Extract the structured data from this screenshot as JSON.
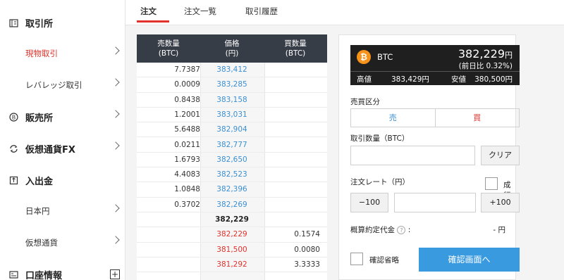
{
  "sidebar": {
    "items": [
      {
        "label": "取引所",
        "icon": "building-icon"
      },
      {
        "label": "現物取引"
      },
      {
        "label": "レバレッジ取引"
      },
      {
        "label": "販売所",
        "icon": "bitcoin-circle-icon"
      },
      {
        "label": "仮想通貨FX",
        "icon": "swap-arrows-icon"
      },
      {
        "label": "入出金",
        "icon": "deposit-icon"
      },
      {
        "label": "日本円"
      },
      {
        "label": "仮想通貨"
      },
      {
        "label": "口座情報",
        "icon": "account-icon"
      }
    ]
  },
  "tabs": [
    "注文",
    "注文一覧",
    "取引履歴"
  ],
  "orderbook": {
    "headers": {
      "sell": [
        "売数量",
        "(BTC)"
      ],
      "price": [
        "価格",
        "(円)"
      ],
      "buy": [
        "買数量",
        "(BTC)"
      ]
    },
    "asks": [
      {
        "qty": "7.7387",
        "price": "383,412"
      },
      {
        "qty": "0.0009",
        "price": "383,285"
      },
      {
        "qty": "0.8438",
        "price": "383,158"
      },
      {
        "qty": "1.2001",
        "price": "383,031"
      },
      {
        "qty": "5.6488",
        "price": "382,904"
      },
      {
        "qty": "0.0211",
        "price": "382,777"
      },
      {
        "qty": "1.6793",
        "price": "382,650"
      },
      {
        "qty": "4.4083",
        "price": "382,523"
      },
      {
        "qty": "1.0848",
        "price": "382,396"
      },
      {
        "qty": "0.3702",
        "price": "382,269"
      }
    ],
    "mid": "382,229",
    "bids": [
      {
        "qty": "0.1574",
        "price": "382,229"
      },
      {
        "qty": "0.0080",
        "price": "381,500"
      },
      {
        "qty": "3.3333",
        "price": "381,292"
      }
    ]
  },
  "ticker": {
    "symbol": "BTC",
    "price": "382,229",
    "yen": "円",
    "change": "(前日比 0.32%)",
    "high_label": "高値",
    "high": "383,429円",
    "low_label": "安値",
    "low": "380,500円"
  },
  "form": {
    "side_label": "売買区分",
    "sell": "売",
    "buy": "買",
    "qty_label": "取引数量（BTC）",
    "clear": "クリア",
    "rate_label": "注文レート（円）",
    "market": "成行",
    "minus": "−100",
    "plus": "+100",
    "estimate_label": "概算約定代金",
    "estimate_colon": ":",
    "estimate_value": "- 円",
    "skip_confirm": "確認省略",
    "confirm": "確認画面へ"
  },
  "colors": {
    "accent_red": "#e0322b",
    "blue": "#3b8fd1",
    "btn_blue": "#3a9ae0"
  }
}
